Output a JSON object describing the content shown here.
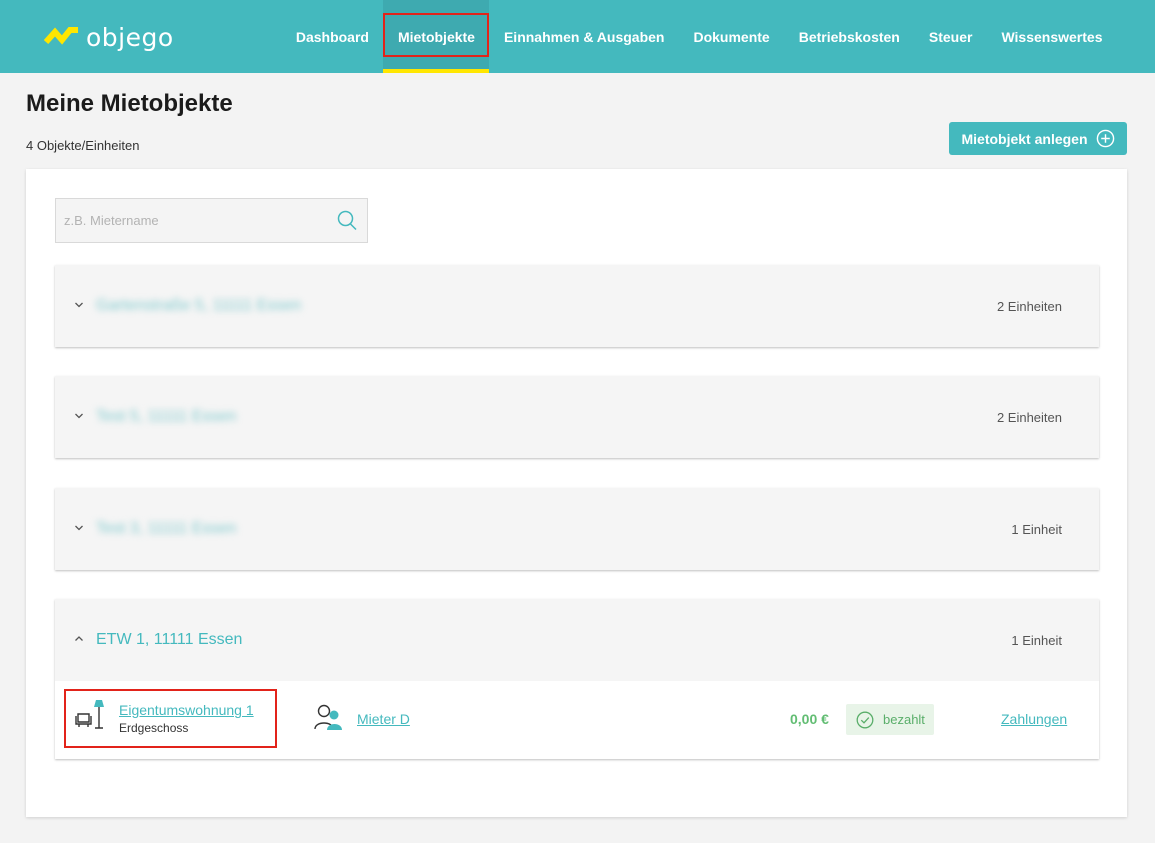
{
  "brand": {
    "name": "objego",
    "accent": "#44b9be",
    "highlight": "#ffe600",
    "logo_color": "#ffe600"
  },
  "nav": {
    "items": [
      {
        "label": "Dashboard"
      },
      {
        "label": "Mietobjekte",
        "active": true
      },
      {
        "label": "Einnahmen & Ausgaben"
      },
      {
        "label": "Dokumente"
      },
      {
        "label": "Betriebskosten"
      },
      {
        "label": "Steuer"
      },
      {
        "label": "Wissenswertes"
      }
    ]
  },
  "page": {
    "title": "Meine Mietobjekte",
    "subtitle": "4 Objekte/Einheiten",
    "add_button": {
      "label": "Mietobjekt anlegen",
      "icon": "plus-circle-icon"
    }
  },
  "search": {
    "placeholder": "z.B. Mietername",
    "value": "",
    "icon": "search-icon"
  },
  "properties": [
    {
      "address": "Gartenstraße 5, 11111 Essen",
      "units": "2 Einheiten",
      "expanded": false,
      "redacted": true
    },
    {
      "address": "Test 5, 11111 Essen",
      "units": "2 Einheiten",
      "expanded": false,
      "redacted": true
    },
    {
      "address": "Test 3, 11111 Essen",
      "units": "1 Einheit",
      "expanded": false,
      "redacted": true
    },
    {
      "address": "ETW 1, 11111 Essen",
      "units": "1 Einheit",
      "expanded": true,
      "redacted": false,
      "unit": {
        "name": "Eigentumswohnung 1",
        "floor": "Erdgeschoss",
        "icon": "apartment-furniture-icon",
        "tenant": "Mieter D",
        "tenant_icon": "tenants-icon",
        "amount": "0,00 €",
        "status": "bezahlt",
        "status_icon": "check-circle-icon",
        "payments_link": "Zahlungen"
      }
    }
  ]
}
